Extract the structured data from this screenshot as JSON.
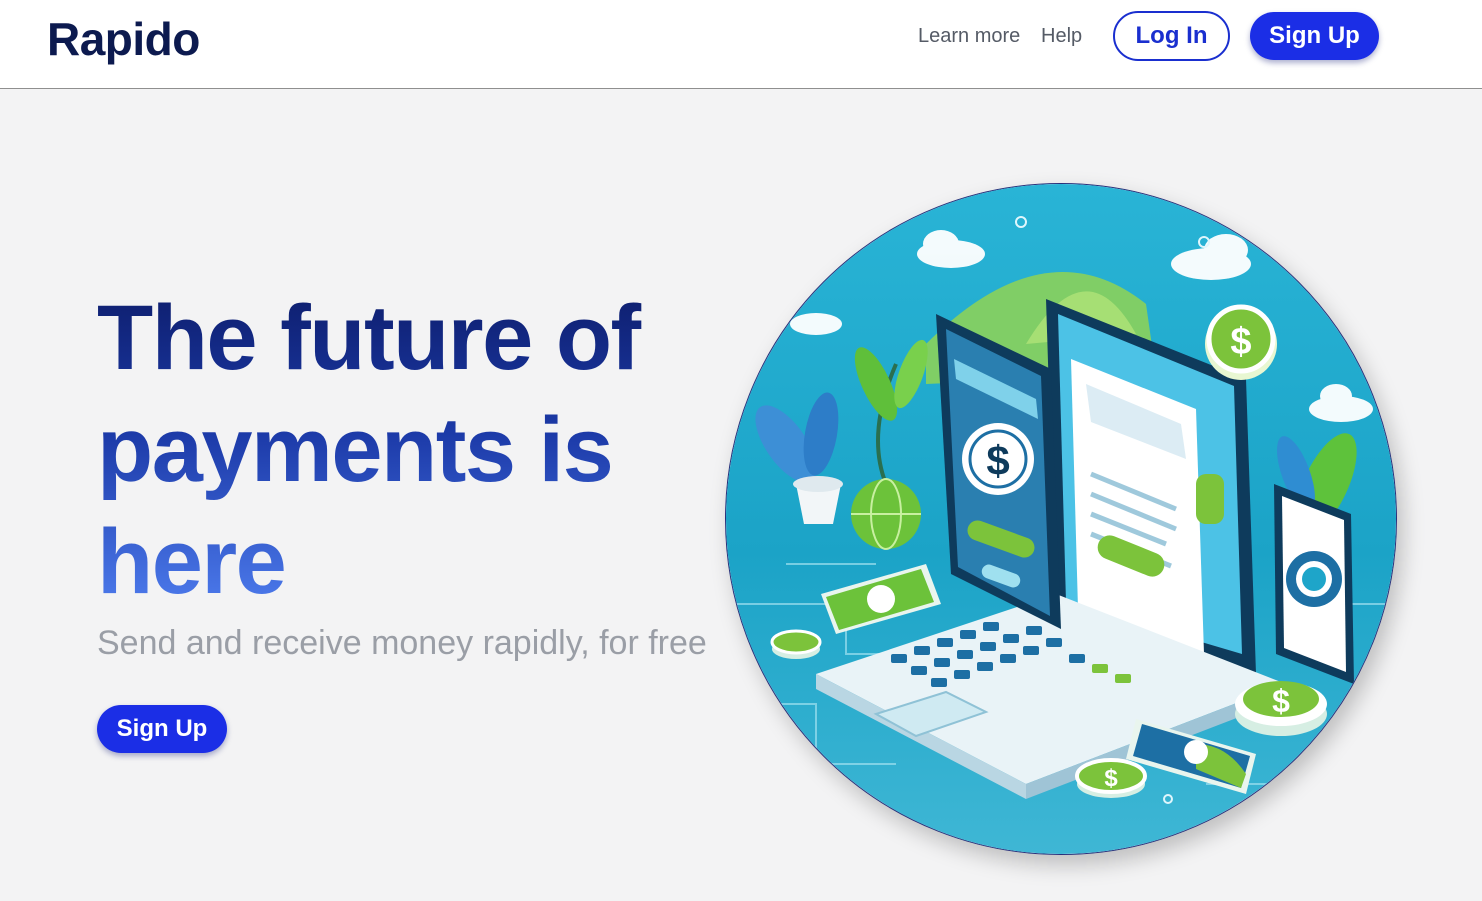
{
  "navbar": {
    "logo": "Rapido",
    "links": {
      "learn_more": "Learn more",
      "help": "Help"
    },
    "login_label": "Log In",
    "signup_label": "Sign Up"
  },
  "hero": {
    "title_line1": "The future of",
    "title_line2": "payments is",
    "title_line3": "here",
    "subtitle": "Send and receive money rapidly, for free",
    "signup_label": "Sign Up"
  },
  "illustration": {
    "currency_symbol": "$"
  },
  "colors": {
    "brand_dark": "#0c1a4f",
    "accent_blue": "#1b2ee6",
    "illustration_teal": "#1ea5c9",
    "illustration_green": "#7cc33b"
  }
}
